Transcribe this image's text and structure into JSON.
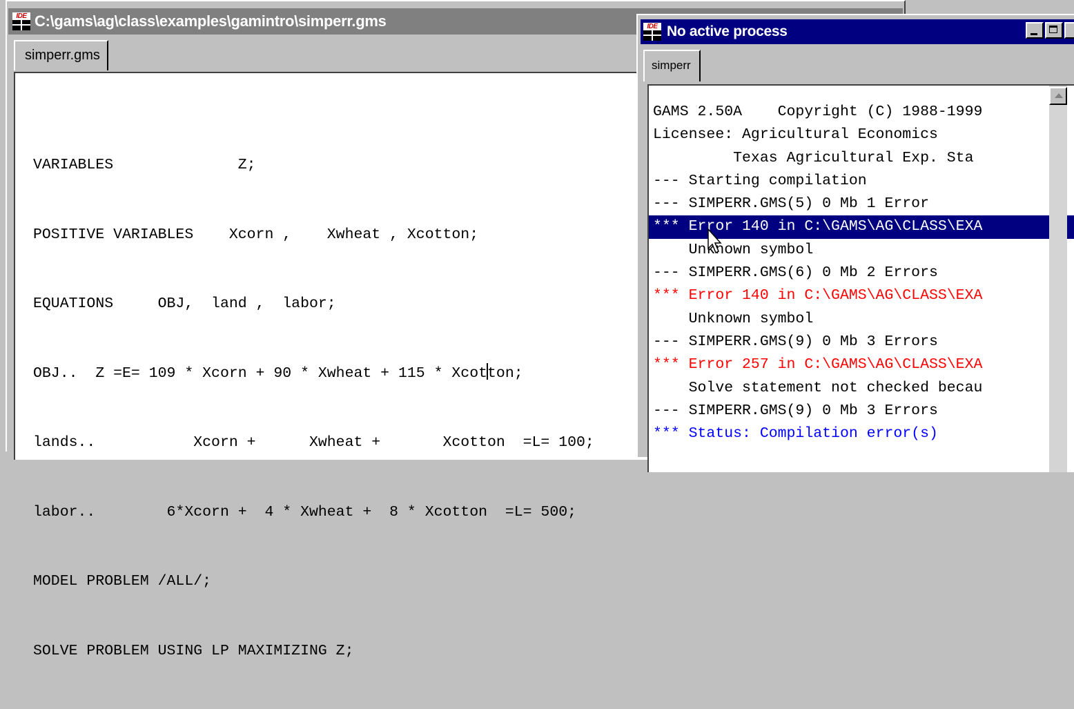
{
  "editor": {
    "title": "C:\\gams\\ag\\class\\examples\\gamintro\\simperr.gms",
    "tab_label": "simperr.gms",
    "code_lines": [
      "VARIABLES              Z;",
      "POSITIVE VARIABLES    Xcorn ,    Xwheat , Xcotton;",
      "EQUATIONS     OBJ,  land ,  labor;",
      "OBJ..  Z =E= 109 * Xcorn + 90 * Xwheat + 115 * Xcotton;",
      "lands..           Xcorn +      Xwheat +       Xcotton  =L= 100;",
      "labor..        6*Xcorn +  4 * Xwheat +  8 * Xcotton  =L= 500;",
      "MODEL PROBLEM /ALL/;",
      "SOLVE PROBLEM USING LP MAXIMIZING Z;"
    ]
  },
  "process_window": {
    "title": "No active process",
    "tab_label": "simperr",
    "log_lines": [
      {
        "text": "GAMS 2.50A    Copyright (C) 1988-1999",
        "color": "black",
        "selected": false
      },
      {
        "text": "Licensee: Agricultural Economics",
        "color": "black",
        "selected": false
      },
      {
        "text": "         Texas Agricultural Exp. Sta",
        "color": "black",
        "selected": false
      },
      {
        "text": "--- Starting compilation",
        "color": "black",
        "selected": false
      },
      {
        "text": "--- SIMPERR.GMS(5) 0 Mb 1 Error",
        "color": "black",
        "selected": false
      },
      {
        "text": "*** Error 140 in C:\\GAMS\\AG\\CLASS\\EXA",
        "color": "white",
        "selected": true
      },
      {
        "text": "    Unknown symbol",
        "color": "black",
        "selected": false
      },
      {
        "text": "--- SIMPERR.GMS(6) 0 Mb 2 Errors",
        "color": "black",
        "selected": false
      },
      {
        "text": "*** Error 140 in C:\\GAMS\\AG\\CLASS\\EXA",
        "color": "red",
        "selected": false
      },
      {
        "text": "    Unknown symbol",
        "color": "black",
        "selected": false
      },
      {
        "text": "--- SIMPERR.GMS(9) 0 Mb 3 Errors",
        "color": "black",
        "selected": false
      },
      {
        "text": "*** Error 257 in C:\\GAMS\\AG\\CLASS\\EXA",
        "color": "red",
        "selected": false
      },
      {
        "text": "    Solve statement not checked becau",
        "color": "black",
        "selected": false
      },
      {
        "text": "--- SIMPERR.GMS(9) 0 Mb 3 Errors",
        "color": "black",
        "selected": false
      },
      {
        "text": "*** Status: Compilation error(s)",
        "color": "blue",
        "selected": false
      }
    ]
  },
  "icons": {
    "app_icon": "ide-icon",
    "app_icon_text": "IDE",
    "minimize": "minimize-icon",
    "maximize": "maximize-icon",
    "scroll_up": "scroll-up-arrow-icon",
    "pointer": "mouse-pointer-icon"
  },
  "colors": {
    "inactive_title": "#808080",
    "active_title": "#000080",
    "error_text": "#ff0000",
    "status_text": "#0000ff",
    "selection": "#000080"
  }
}
